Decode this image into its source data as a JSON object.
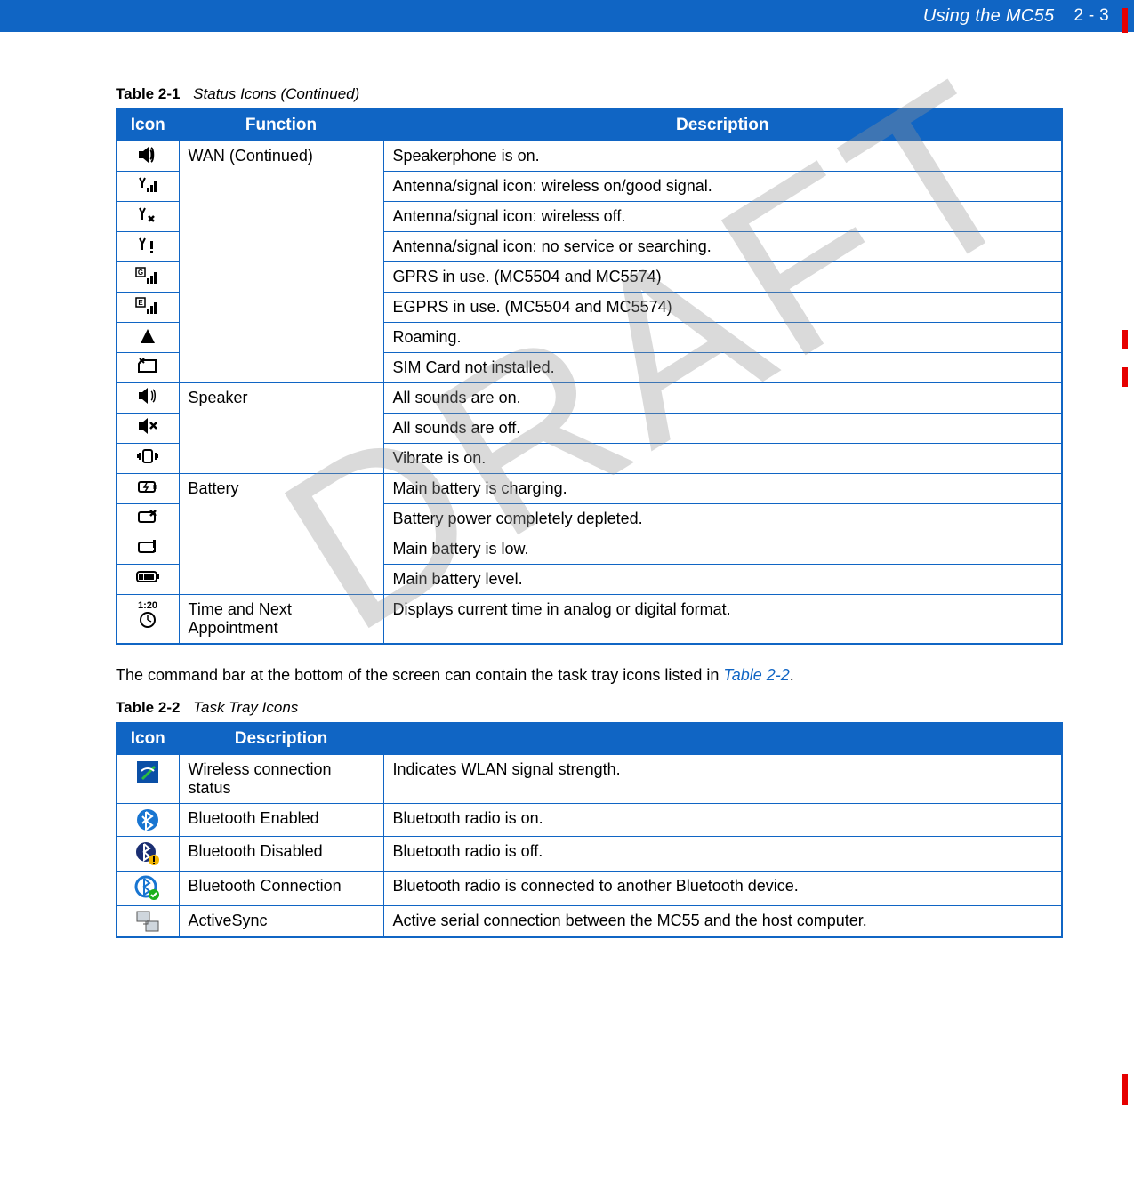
{
  "header": {
    "title": "Using the MC55",
    "pagenum": "2 - 3"
  },
  "watermark": "DRAFT",
  "table1": {
    "num": "Table 2-1",
    "title": "Status Icons (Continued)",
    "headers": {
      "icon": "Icon",
      "function": "Function",
      "description": "Description"
    },
    "rows": [
      {
        "icon": "speakerphone",
        "function": "WAN (Continued)",
        "description": "Speakerphone is on."
      },
      {
        "icon": "antenna-good",
        "function": "",
        "description": "Antenna/signal icon: wireless on/good signal."
      },
      {
        "icon": "antenna-off",
        "function": "",
        "description": "Antenna/signal icon: wireless off."
      },
      {
        "icon": "antenna-search",
        "function": "",
        "description": "Antenna/signal icon: no service or searching."
      },
      {
        "icon": "gprs",
        "function": "",
        "description": "GPRS in use. (MC5504 and MC5574)"
      },
      {
        "icon": "egprs",
        "function": "",
        "description": "EGPRS in use. (MC5504 and MC5574)"
      },
      {
        "icon": "roaming",
        "function": "",
        "description": "Roaming."
      },
      {
        "icon": "sim-missing",
        "function": "",
        "description": "SIM Card not installed."
      },
      {
        "icon": "speaker-on",
        "function": "Speaker",
        "description": "All sounds are on."
      },
      {
        "icon": "speaker-off",
        "function": "",
        "description": "All sounds are off."
      },
      {
        "icon": "vibrate",
        "function": "",
        "description": "Vibrate is on."
      },
      {
        "icon": "battery-charging",
        "function": "Battery",
        "description": "Main battery is charging."
      },
      {
        "icon": "battery-depleted",
        "function": "",
        "description": "Battery power completely depleted."
      },
      {
        "icon": "battery-low",
        "function": "",
        "description": "Main battery is low."
      },
      {
        "icon": "battery-level",
        "function": "",
        "description": "Main battery level."
      },
      {
        "icon": "time-appt",
        "function": "Time and Next Appointment",
        "description": "Displays current time in analog or digital format."
      }
    ]
  },
  "betweenText": {
    "prefix": "The command bar at the bottom of the screen can contain the task tray icons listed in ",
    "ref": "Table 2-2",
    "suffix": "."
  },
  "table2": {
    "num": "Table 2-2",
    "title": "Task Tray Icons",
    "headers": {
      "icon": "Icon",
      "description": "Description",
      "blank": ""
    },
    "rows": [
      {
        "icon": "wlan",
        "description": "Wireless connection status",
        "detail": "Indicates WLAN signal strength."
      },
      {
        "icon": "bt-enabled",
        "description": "Bluetooth Enabled",
        "detail": "Bluetooth radio is on."
      },
      {
        "icon": "bt-disabled",
        "description": "Bluetooth Disabled",
        "detail": "Bluetooth radio is off."
      },
      {
        "icon": "bt-connection",
        "description": "Bluetooth Connection",
        "detail": "Bluetooth radio is connected to another Bluetooth device."
      },
      {
        "icon": "activesync",
        "description": "ActiveSync",
        "detail": "Active serial connection between the MC55 and the host computer."
      }
    ]
  }
}
